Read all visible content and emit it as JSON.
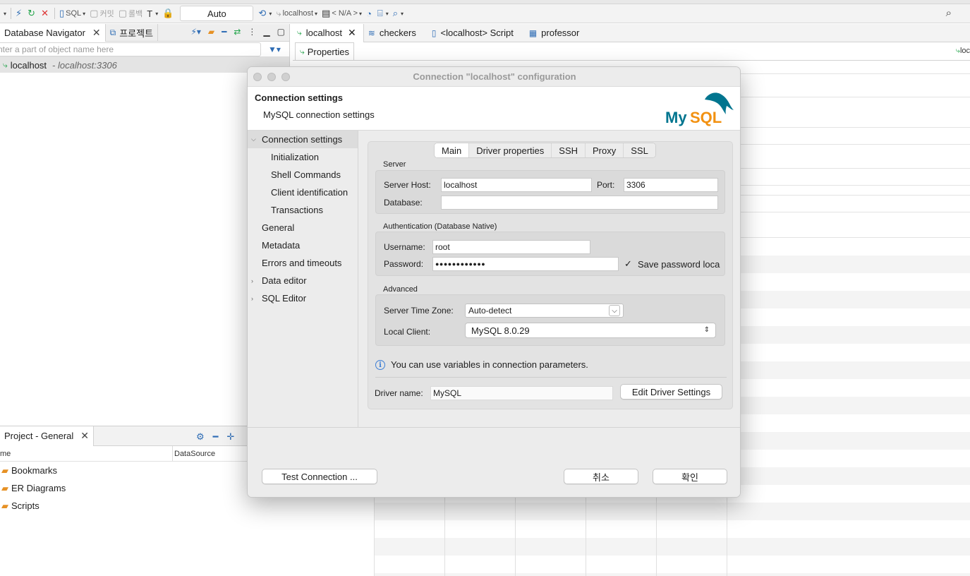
{
  "toolbar": {
    "sql_label": "SQL",
    "commit_label": "커밋",
    "rollback_label": "롤백",
    "auto_label": "Auto",
    "connection_label": "localhost",
    "schema_label": "< N/A >"
  },
  "navigator": {
    "tab_label": "Database Navigator",
    "project_tab_label": "프로젝트",
    "filter_placeholder": "nter a part of object name here",
    "item_label": "localhost",
    "item_sub": "- localhost:3306"
  },
  "project": {
    "tab_label": "Project - General",
    "col_name": "me",
    "col_datasource": "DataSource",
    "items": [
      "Bookmarks",
      "ER Diagrams",
      "Scripts"
    ]
  },
  "editor": {
    "tabs": [
      "localhost",
      "checkers",
      "<localhost> Script",
      "professor"
    ],
    "sub_tab": "Properties",
    "right_cut": "loc"
  },
  "dialog": {
    "title": "Connection \"localhost\" configuration",
    "header_title": "Connection settings",
    "header_subtitle": "MySQL connection settings",
    "logo_text": "MySQL",
    "nav": [
      {
        "label": "Connection settings",
        "expanded": true
      },
      {
        "label": "Initialization"
      },
      {
        "label": "Shell Commands"
      },
      {
        "label": "Client identification"
      },
      {
        "label": "Transactions"
      },
      {
        "label": "General"
      },
      {
        "label": "Metadata"
      },
      {
        "label": "Errors and timeouts"
      },
      {
        "label": "Data editor",
        "collapsed": true
      },
      {
        "label": "SQL Editor",
        "collapsed": true
      }
    ],
    "tabs": [
      "Main",
      "Driver properties",
      "SSH",
      "Proxy",
      "SSL"
    ],
    "server": {
      "group_label": "Server",
      "host_label": "Server Host:",
      "host_value": "localhost",
      "port_label": "Port:",
      "port_value": "3306",
      "database_label": "Database:",
      "database_value": ""
    },
    "auth": {
      "group_label": "Authentication (Database Native)",
      "username_label": "Username:",
      "username_value": "root",
      "password_label": "Password:",
      "password_value": "●●●●●●●●●●●●",
      "save_password_label": "Save password loca",
      "save_password_checked": true
    },
    "advanced": {
      "group_label": "Advanced",
      "timezone_label": "Server Time Zone:",
      "timezone_value": "Auto-detect",
      "client_label": "Local Client:",
      "client_value": "MySQL 8.0.29"
    },
    "info_text": "You can use variables in connection parameters.",
    "driver_label": "Driver name:",
    "driver_value": "MySQL",
    "edit_driver_label": "Edit Driver Settings",
    "test_connection_label": "Test Connection ...",
    "cancel_label": "취소",
    "ok_label": "확인"
  },
  "colors": {
    "accent_blue": "#2f6db5",
    "mysql_blue": "#00758f",
    "mysql_orange": "#f29111"
  }
}
